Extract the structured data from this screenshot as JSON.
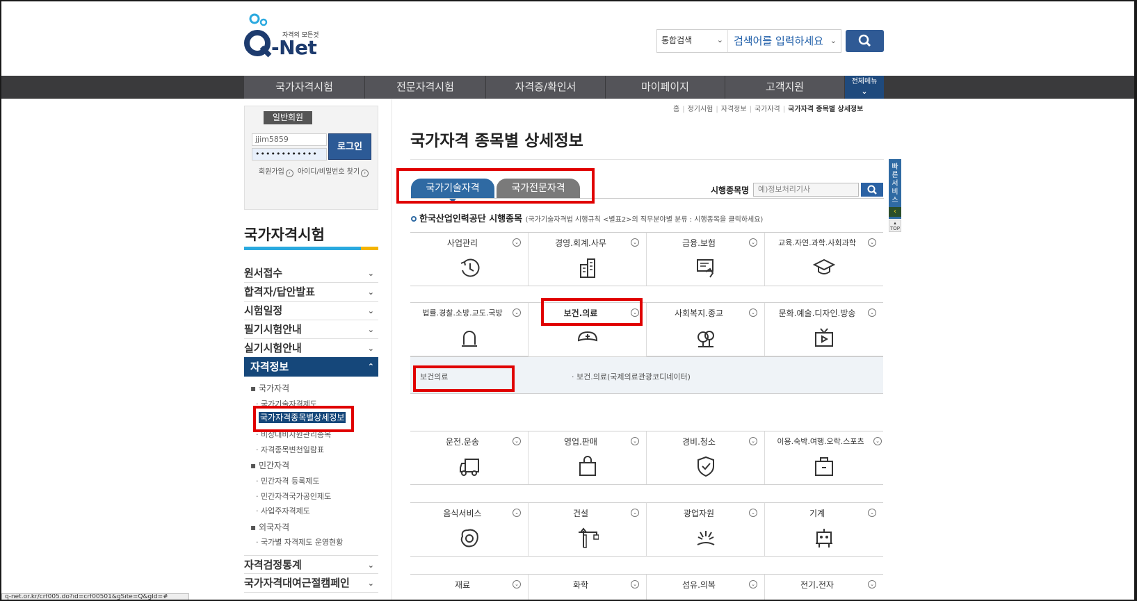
{
  "header": {
    "logo_tagline": "자격의 모든것",
    "logo_text": "-Net",
    "search_scope": "통합검색",
    "search_placeholder": "검색어를 입력하세요"
  },
  "nav": {
    "items": [
      "국가자격시험",
      "전문자격시험",
      "자격증/확인서",
      "마이페이지",
      "고객지원"
    ],
    "all_menu": "전체메뉴"
  },
  "login": {
    "member_tab": "일반회원",
    "id_value": "jjim5859",
    "pw_value": "••••••••••••",
    "login_button": "로그인",
    "signup": "회원가입",
    "find_account": "아이디/비밀번호 찾기"
  },
  "sidebar": {
    "title": "국가자격시험",
    "menu": [
      "원서접수",
      "합격자/답안발표",
      "시험일정",
      "필기시험안내",
      "실기시험안내"
    ],
    "active": "자격정보",
    "sub": [
      {
        "level": 1,
        "label": "국가자격"
      },
      {
        "level": 2,
        "label": "국가기술자격제도"
      },
      {
        "level": 2,
        "label": "국가자격종목별상세정보"
      },
      {
        "level": 2,
        "label": "비상대비자원관리종목"
      },
      {
        "level": 2,
        "label": "자격종목변천일람표"
      },
      {
        "level": 1,
        "label": "민간자격"
      },
      {
        "level": 2,
        "label": "민간자격 등록제도"
      },
      {
        "level": 2,
        "label": "민간자격국가공인제도"
      },
      {
        "level": 2,
        "label": "사업주자격제도"
      },
      {
        "level": 1,
        "label": "외국자격"
      },
      {
        "level": 2,
        "label": "국가별 자격제도 운영현황"
      }
    ],
    "bottom_menu": [
      "자격검정통계",
      "국가자격대여근절캠페인"
    ]
  },
  "breadcrumb": [
    "홈",
    "정기시험",
    "자격정보",
    "국가자격",
    "국가자격 종목별 상세정보"
  ],
  "main": {
    "title": "국가자격 종목별 상세정보",
    "tabs": [
      "국가기술자격",
      "국가전문자격"
    ],
    "item_search_label": "시행종목명",
    "item_search_placeholder": "예)정보처리기사",
    "section_title": "한국산업인력공단 시행종목",
    "section_note": "(국가기술자격법 시행규칙 <별표2>의 직무분야별 분류 : 시행종목을 클릭하세요)",
    "categories": [
      [
        "사업관리",
        "경영.회계.사무",
        "금융.보험",
        "교육.자연.과학.사회과학"
      ],
      [
        "법률.경찰.소방.교도.국방",
        "보건.의료",
        "사회복지.종교",
        "문화.예술.디자인.방송"
      ],
      [
        "운전.운송",
        "영업.판매",
        "경비.청소",
        "이용.숙박.여행.오락.스포츠"
      ],
      [
        "음식서비스",
        "건설",
        "광업자원",
        "기계"
      ],
      [
        "재료",
        "화학",
        "섬유.의복",
        "전기.전자"
      ]
    ],
    "expand_left": "보건의료",
    "expand_right": "· 보건.의료(국제의료관광코디네이터)"
  },
  "quick_service": "빠른서비스",
  "top_label": "TOP",
  "status_url": "q-net.or.kr/crf005.do?id=crf00501&gSite=Q&gId=#",
  "colors": {
    "brand": "#1d3b6e",
    "accent": "#2f6aa3",
    "highlight": "#e00000"
  }
}
